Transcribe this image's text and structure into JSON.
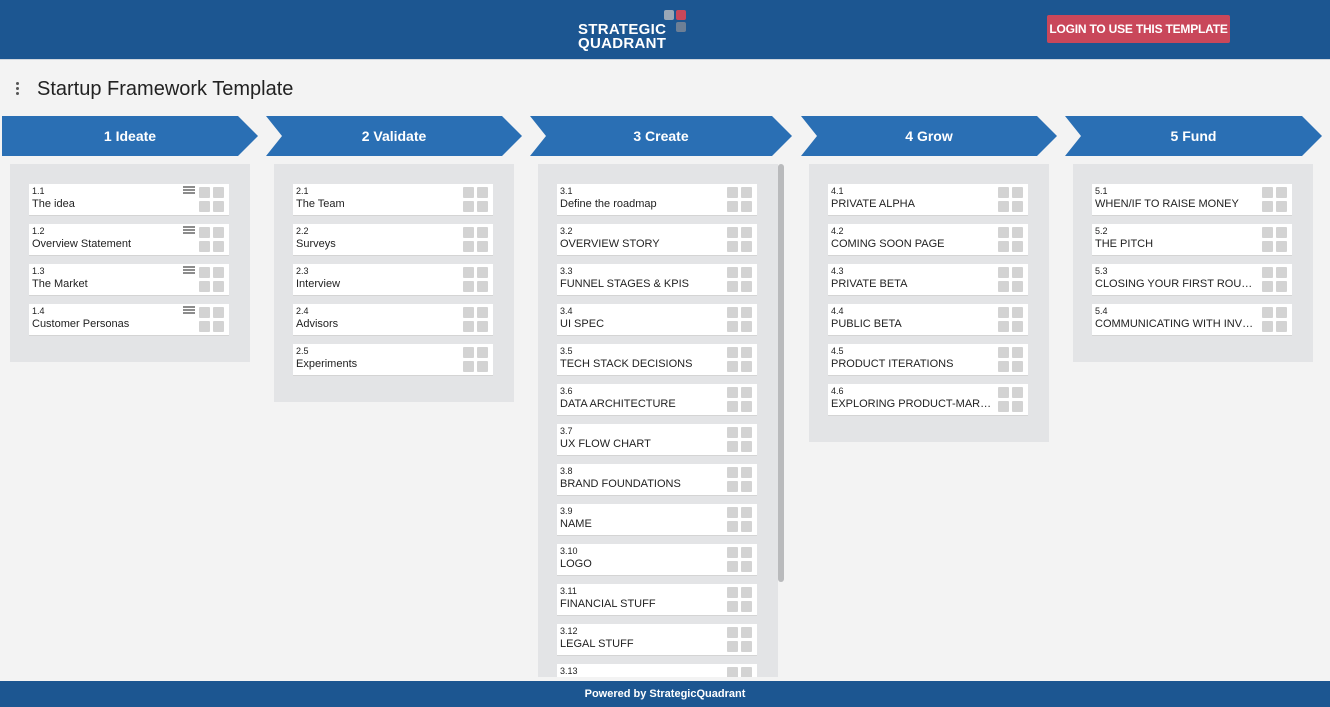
{
  "header": {
    "logo_line1": "STRATEGIC",
    "logo_line2": "QUADRANT",
    "login_label": "LOGIN TO USE THIS TEMPLATE"
  },
  "page_title": "Startup Framework Template",
  "stages": [
    {
      "label": "1 Ideate"
    },
    {
      "label": "2 Validate"
    },
    {
      "label": "3 Create"
    },
    {
      "label": "4 Grow"
    },
    {
      "label": "5 Fund"
    }
  ],
  "columns": [
    {
      "cards": [
        {
          "num": "1.1",
          "name": "The idea",
          "list_icon": true
        },
        {
          "num": "1.2",
          "name": "Overview Statement",
          "list_icon": true
        },
        {
          "num": "1.3",
          "name": "The Market",
          "list_icon": true
        },
        {
          "num": "1.4",
          "name": "Customer Personas",
          "list_icon": true
        }
      ]
    },
    {
      "cards": [
        {
          "num": "2.1",
          "name": "The Team"
        },
        {
          "num": "2.2",
          "name": "Surveys"
        },
        {
          "num": "2.3",
          "name": "Interview"
        },
        {
          "num": "2.4",
          "name": "Advisors"
        },
        {
          "num": "2.5",
          "name": "Experiments"
        }
      ]
    },
    {
      "cards": [
        {
          "num": "3.1",
          "name": "Define the roadmap"
        },
        {
          "num": "3.2",
          "name": "OVERVIEW STORY"
        },
        {
          "num": "3.3",
          "name": "FUNNEL STAGES & KPIS"
        },
        {
          "num": "3.4",
          "name": "UI SPEC"
        },
        {
          "num": "3.5",
          "name": "TECH STACK DECISIONS"
        },
        {
          "num": "3.6",
          "name": "DATA ARCHITECTURE"
        },
        {
          "num": "3.7",
          "name": "UX FLOW CHART"
        },
        {
          "num": "3.8",
          "name": "BRAND FOUNDATIONS"
        },
        {
          "num": "3.9",
          "name": "NAME"
        },
        {
          "num": "3.10",
          "name": "LOGO"
        },
        {
          "num": "3.11",
          "name": "FINANCIAL STUFF"
        },
        {
          "num": "3.12",
          "name": "LEGAL STUFF"
        },
        {
          "num": "3.13",
          "name": ""
        }
      ]
    },
    {
      "cards": [
        {
          "num": "4.1",
          "name": "PRIVATE ALPHA"
        },
        {
          "num": "4.2",
          "name": "COMING SOON PAGE"
        },
        {
          "num": "4.3",
          "name": "PRIVATE BETA"
        },
        {
          "num": "4.4",
          "name": "PUBLIC BETA"
        },
        {
          "num": "4.5",
          "name": "PRODUCT ITERATIONS"
        },
        {
          "num": "4.6",
          "name": "EXPLORING PRODUCT-MARKET…"
        }
      ]
    },
    {
      "cards": [
        {
          "num": "5.1",
          "name": "WHEN/IF TO RAISE MONEY"
        },
        {
          "num": "5.2",
          "name": "THE PITCH"
        },
        {
          "num": "5.3",
          "name": "CLOSING YOUR FIRST ROUND"
        },
        {
          "num": "5.4",
          "name": "COMMUNICATING WITH INVES…"
        }
      ]
    }
  ],
  "footer": "Powered by StrategicQuadrant",
  "colors": {
    "brand_blue": "#1c5691",
    "stage_blue": "#2a6fb4",
    "login_red": "#c9475a",
    "column_bg": "#e3e4e6"
  }
}
